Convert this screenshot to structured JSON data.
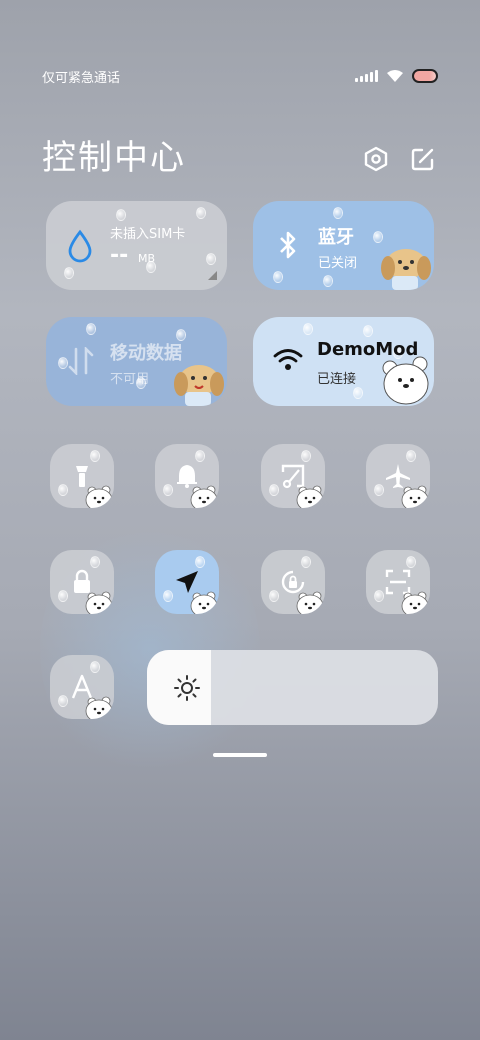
{
  "status_bar": {
    "carrier": "仅可紧急通话",
    "battery_color": "#f1a7a2"
  },
  "header": {
    "title": "控制中心"
  },
  "tiles": {
    "sim": {
      "title": "未插入SIM卡",
      "value": "--",
      "unit": "MB"
    },
    "bluetooth": {
      "title": "蓝牙",
      "status": "已关闭"
    },
    "mobile_data": {
      "title": "移动数据",
      "status": "不可用"
    },
    "wifi": {
      "title": "DemoMod",
      "status": "已连接"
    }
  },
  "quick_toggles": [
    {
      "name": "flashlight",
      "icon": "flashlight-icon",
      "active": false
    },
    {
      "name": "silent",
      "icon": "bell-icon",
      "active": false
    },
    {
      "name": "screenshot",
      "icon": "screenshot-icon",
      "active": false
    },
    {
      "name": "airplane",
      "icon": "airplane-icon",
      "active": false
    },
    {
      "name": "lock-screen",
      "icon": "lock-icon",
      "active": false
    },
    {
      "name": "location",
      "icon": "location-icon",
      "active": true
    },
    {
      "name": "rotation-lock",
      "icon": "rotation-lock-icon",
      "active": false
    },
    {
      "name": "scanner",
      "icon": "scan-icon",
      "active": false
    },
    {
      "name": "font-size",
      "icon": "font-icon",
      "active": false
    }
  ],
  "brightness": {
    "level": 0.22
  },
  "colors": {
    "accent_blue": "#9ec0e6",
    "tile_gray": "#cdcfd3",
    "water_blue": "#2a8ae6"
  }
}
